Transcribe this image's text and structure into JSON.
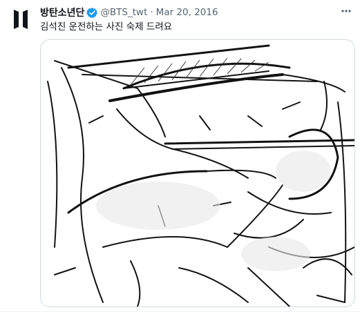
{
  "tweet": {
    "display_name": "방탄소년단",
    "handle": "@BTS_twt",
    "separator": "·",
    "timestamp": "Mar 20, 2016",
    "text": "김석진 운전하는 사진 숙제 드려요",
    "verified": true
  },
  "icons": {
    "avatar": "bts-logo-icon",
    "verified": "verified-badge-icon",
    "more": "more-options-icon"
  },
  "colors": {
    "text_primary": "#0f1419",
    "text_secondary": "#536471",
    "verified": "#1d9bf0",
    "media_border": "#cfd9de"
  }
}
